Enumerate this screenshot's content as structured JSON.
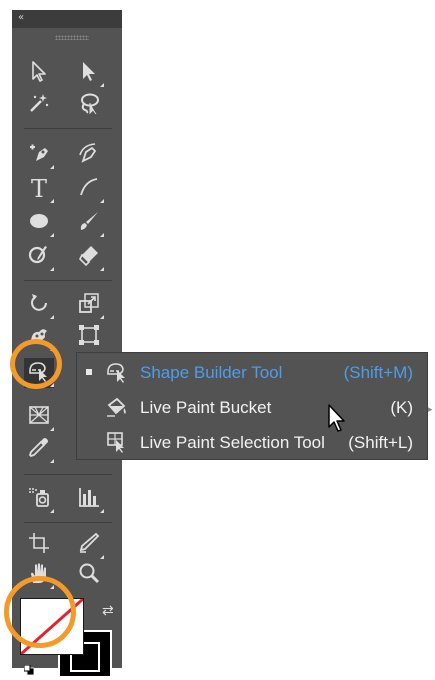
{
  "toolbar": {
    "collapse_glyph": "«",
    "tools": [
      {
        "name": "selection-tool-icon"
      },
      {
        "name": "direct-selection-tool-icon"
      },
      {
        "name": "magic-wand-tool-icon"
      },
      {
        "name": "lasso-tool-icon"
      },
      {
        "name": "pen-tool-icon"
      },
      {
        "name": "curvature-tool-icon"
      },
      {
        "name": "type-tool-icon",
        "glyph": "T"
      },
      {
        "name": "line-segment-tool-icon"
      },
      {
        "name": "ellipse-tool-icon"
      },
      {
        "name": "paintbrush-tool-icon"
      },
      {
        "name": "shaper-tool-icon"
      },
      {
        "name": "eraser-tool-icon"
      },
      {
        "name": "rotate-tool-icon"
      },
      {
        "name": "scale-tool-icon"
      },
      {
        "name": "puppet-warp-tool-icon"
      },
      {
        "name": "free-transform-tool-icon"
      },
      {
        "name": "shape-builder-tool-icon"
      },
      {
        "name": "perspective-grid-tool-icon"
      },
      {
        "name": "eyedropper-tool-icon"
      },
      {
        "name": "blend-tool-icon"
      },
      {
        "name": "symbol-sprayer-tool-icon"
      },
      {
        "name": "column-graph-tool-icon"
      },
      {
        "name": "artboard-tool-icon"
      },
      {
        "name": "slice-tool-icon"
      },
      {
        "name": "hand-tool-icon"
      },
      {
        "name": "zoom-tool-icon"
      }
    ],
    "fill": "none",
    "stroke": "black"
  },
  "flyout": {
    "items": [
      {
        "label": "Shape Builder Tool",
        "shortcut": "(Shift+M)",
        "selected": true
      },
      {
        "label": "Live Paint Bucket",
        "shortcut": "(K)",
        "selected": false
      },
      {
        "label": "Live Paint Selection Tool",
        "shortcut": "(Shift+L)",
        "selected": false
      }
    ]
  },
  "colors": {
    "panel": "#535353",
    "highlight_ring": "#f39a2a",
    "active_label": "#4f9ce8",
    "none_slash": "#e0252b"
  }
}
